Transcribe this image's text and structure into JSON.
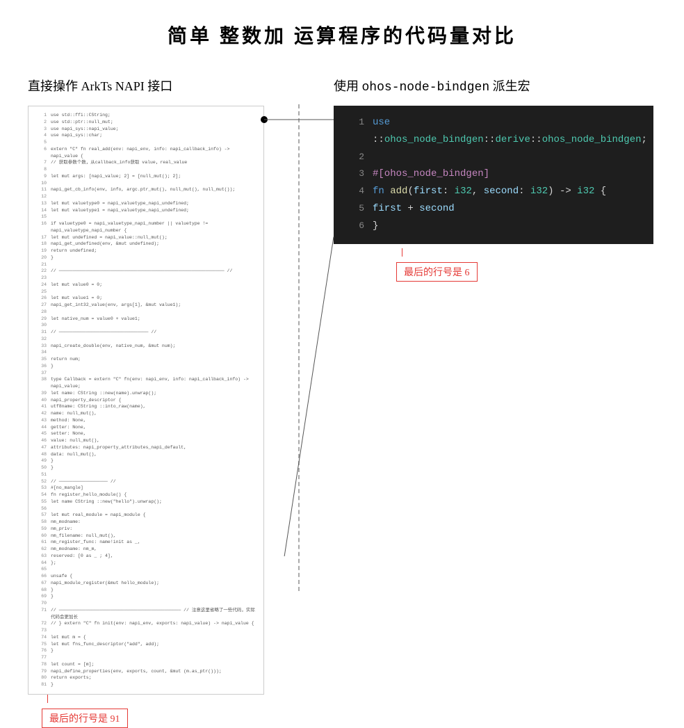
{
  "page": {
    "title": "简单  整数加  运算程序的代码量对比"
  },
  "left": {
    "header": "直接操作 ArkTs NAPI 接口",
    "annotation": "最后的行号是 91",
    "lines": [
      {
        "num": "1",
        "code": "use std::ffi::CString;"
      },
      {
        "num": "2",
        "code": "use std::ptr::null_mut;"
      },
      {
        "num": "3",
        "code": "use napi_sys::napi_value;"
      },
      {
        "num": "4",
        "code": "use napi_sys::char;"
      },
      {
        "num": "5",
        "code": ""
      },
      {
        "num": "6",
        "code": "extern \"C\" fn real_add(env: napi_env, info: napi_callback_info) -> napi_value {"
      },
      {
        "num": "7",
        "code": "    // 获取参数个数，从callback_info获取 value，real_value"
      },
      {
        "num": "8",
        "code": ""
      },
      {
        "num": "9",
        "code": "    let mut args: [napi_value; 2] = [null_mut(); 2];"
      },
      {
        "num": "10",
        "code": ""
      },
      {
        "num": "11",
        "code": "    napi_get_cb_info(env, info, argc.ptr_mut(), null_mut(), null_mut());"
      },
      {
        "num": "12",
        "code": ""
      },
      {
        "num": "13",
        "code": "    let mut valuetype0 = napi_valuetype_napi_undefined;"
      },
      {
        "num": "14",
        "code": "    let mut valuetype1 = napi_valuetype_napi_undefined;"
      },
      {
        "num": "15",
        "code": ""
      },
      {
        "num": "16",
        "code": "    if valuetype0 = napi_valuetype_napi_number || valuetype != napi_valuetype_napi_number {"
      },
      {
        "num": "17",
        "code": "        let mut undefined = napi_value::null_mut();"
      },
      {
        "num": "18",
        "code": "        napi_get_undefined(env, &mut undefined);"
      },
      {
        "num": "19",
        "code": "        return undefined;"
      },
      {
        "num": "20",
        "code": "    }"
      },
      {
        "num": "21",
        "code": ""
      },
      {
        "num": "22",
        "code": "    // ───────────────────────────────────────────────────────────── //"
      },
      {
        "num": "23",
        "code": ""
      },
      {
        "num": "24",
        "code": "    let mut value0 = 0;"
      },
      {
        "num": "25",
        "code": ""
      },
      {
        "num": "26",
        "code": "    let mut value1 = 0;"
      },
      {
        "num": "27",
        "code": "    napi_get_int32_value(env, args[1], &mut value1);"
      },
      {
        "num": "28",
        "code": ""
      },
      {
        "num": "29",
        "code": "    let native_num = value0 + value1;"
      },
      {
        "num": "30",
        "code": ""
      },
      {
        "num": "31",
        "code": "    // ───────────────────────────────── //"
      },
      {
        "num": "32",
        "code": ""
      },
      {
        "num": "33",
        "code": "    napi_create_double(env, native_num, &mut num);"
      },
      {
        "num": "34",
        "code": ""
      },
      {
        "num": "35",
        "code": "    return num;"
      },
      {
        "num": "36",
        "code": "}"
      },
      {
        "num": "37",
        "code": ""
      },
      {
        "num": "38",
        "code": "type Callback = extern \"C\" fn(env: napi_env, info: napi_callback_info) -> napi_value;"
      },
      {
        "num": "39",
        "code": "    let name: CString ::new(name).unwrap();"
      },
      {
        "num": "40",
        "code": "    napi_property_descriptor {"
      },
      {
        "num": "41",
        "code": "        utf8name: CString ::into_raw(name),"
      },
      {
        "num": "42",
        "code": "        name: null_mut(),"
      },
      {
        "num": "43",
        "code": "        method: None,"
      },
      {
        "num": "44",
        "code": "        getter: None,"
      },
      {
        "num": "45",
        "code": "        setter: None,"
      },
      {
        "num": "46",
        "code": "        value: null_mut(),"
      },
      {
        "num": "47",
        "code": "        attributes: napi_property_attributes_napi_default,"
      },
      {
        "num": "48",
        "code": "        data: null_mut(),"
      },
      {
        "num": "49",
        "code": "    }"
      },
      {
        "num": "50",
        "code": "}"
      },
      {
        "num": "51",
        "code": ""
      },
      {
        "num": "52",
        "code": "// ────────────────── //"
      },
      {
        "num": "53",
        "code": "#[no_mangle]"
      },
      {
        "num": "54",
        "code": "fn register_hello_module() {"
      },
      {
        "num": "55",
        "code": "    let name CString ::new(\"hello\").unwrap();"
      },
      {
        "num": "56",
        "code": ""
      },
      {
        "num": "57",
        "code": "    let mut real_module = napi_module {"
      },
      {
        "num": "58",
        "code": "        nm_modname:"
      },
      {
        "num": "59",
        "code": "        nm_priv:"
      },
      {
        "num": "60",
        "code": "        nm_filename: null_mut(),"
      },
      {
        "num": "61",
        "code": "        nm_register_func: name!init as _,"
      },
      {
        "num": "62",
        "code": "        nm_modname: nm_m,"
      },
      {
        "num": "63",
        "code": "        reserved: [0 as _ ; 4],"
      },
      {
        "num": "64",
        "code": "    };"
      },
      {
        "num": "65",
        "code": ""
      },
      {
        "num": "66",
        "code": "    unsafe {"
      },
      {
        "num": "67",
        "code": "        napi_module_register(&mut hello_module);"
      },
      {
        "num": "68",
        "code": "    }"
      },
      {
        "num": "69",
        "code": "}"
      },
      {
        "num": "70",
        "code": ""
      },
      {
        "num": "71",
        "code": "// ───────────────────────────────────────────── // 注意这里省略了一些代码，实际代码会更加长"
      },
      {
        "num": "72",
        "code": "// } extern \"C\" fn init(env: napi_env, exports: napi_value) -> napi_value {"
      },
      {
        "num": "73",
        "code": ""
      },
      {
        "num": "74",
        "code": "    let mut m = {"
      },
      {
        "num": "75",
        "code": "        let mut fns_func_descriptor(\"add\", add);"
      },
      {
        "num": "76",
        "code": "    }"
      },
      {
        "num": "77",
        "code": ""
      },
      {
        "num": "78",
        "code": "    let count = [m];"
      },
      {
        "num": "79",
        "code": "    napi_define_properties(env, exports, count, &mut (m.as_ptr()));"
      },
      {
        "num": "80",
        "code": "    return exports;"
      },
      {
        "num": "81",
        "code": "}"
      }
    ]
  },
  "right": {
    "header_prefix": "使用 ",
    "header_mono": "ohos-node-bindgen",
    "header_suffix": " 派生宏",
    "annotation": "最后的行号是 6",
    "lines": [
      {
        "num": "1",
        "code_parts": [
          {
            "type": "kw",
            "text": "use"
          },
          {
            "type": "plain",
            "text": " ::"
          },
          {
            "type": "kw2",
            "text": "ohos_node_bindgen"
          },
          {
            "type": "plain",
            "text": "::"
          },
          {
            "type": "kw2",
            "text": "derive"
          },
          {
            "type": "plain",
            "text": "::"
          },
          {
            "type": "kw2",
            "text": "ohos_node_bindgen"
          },
          {
            "type": "plain",
            "text": ";"
          }
        ]
      },
      {
        "num": "2",
        "code_parts": []
      },
      {
        "num": "3",
        "code_parts": [
          {
            "type": "macro",
            "text": "#[ohos_node_bindgen]"
          }
        ]
      },
      {
        "num": "4",
        "code_parts": [
          {
            "type": "kw",
            "text": "fn"
          },
          {
            "type": "plain",
            "text": " "
          },
          {
            "type": "fn-name",
            "text": "add"
          },
          {
            "type": "plain",
            "text": "("
          },
          {
            "type": "attr",
            "text": "first"
          },
          {
            "type": "plain",
            "text": ": "
          },
          {
            "type": "type",
            "text": "i32"
          },
          {
            "type": "plain",
            "text": ", "
          },
          {
            "type": "attr",
            "text": "second"
          },
          {
            "type": "plain",
            "text": ": "
          },
          {
            "type": "type",
            "text": "i32"
          },
          {
            "type": "plain",
            "text": ") -> "
          },
          {
            "type": "type",
            "text": "i32"
          },
          {
            "type": "plain",
            "text": " {"
          }
        ]
      },
      {
        "num": "5",
        "code_parts": [
          {
            "type": "plain",
            "text": "    "
          },
          {
            "type": "attr",
            "text": "first"
          },
          {
            "type": "plain",
            "text": " + "
          },
          {
            "type": "attr",
            "text": "second"
          }
        ]
      },
      {
        "num": "6",
        "code_parts": [
          {
            "type": "plain",
            "text": "}"
          }
        ]
      }
    ]
  },
  "connector": {
    "dot1_label": "top bullet",
    "dot2_label": "bottom bullet"
  }
}
